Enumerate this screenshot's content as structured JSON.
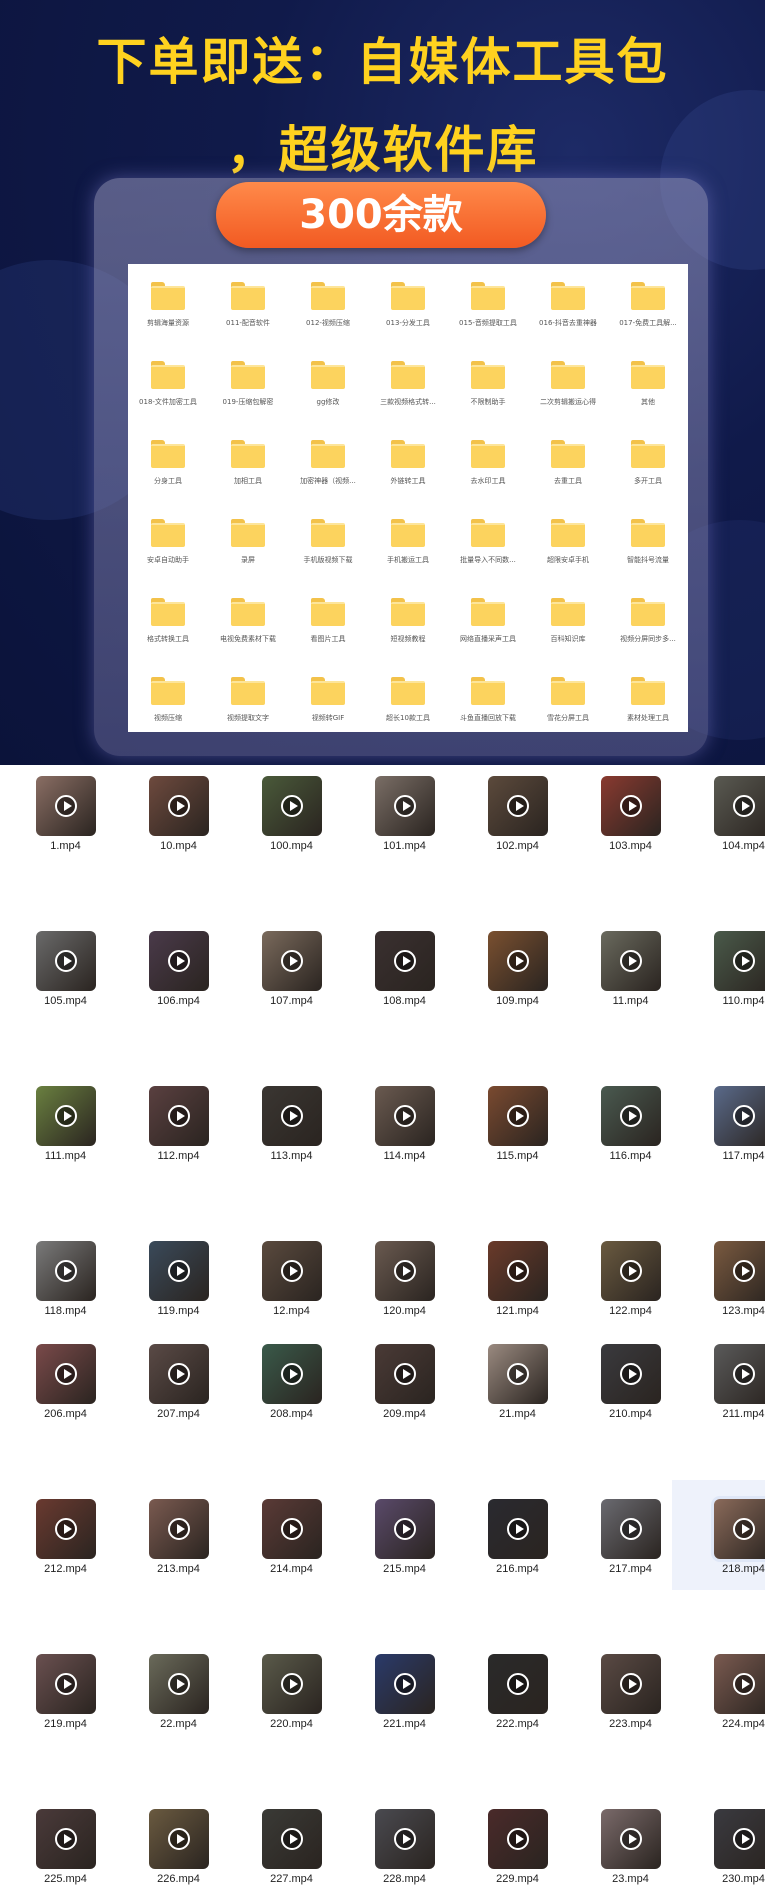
{
  "promo": {
    "title_line_1": "下单即送：自媒体工具包",
    "title_line_2": "，超级软件库",
    "badge": "300余款",
    "colors": {
      "title": "#ffd21f",
      "background": "#0b133a",
      "badge": "#f25a22",
      "folder": "#fcd35e"
    },
    "folders": [
      "剪辑海量资源",
      "011-配音软件",
      "012-视频压缩",
      "013-分发工具",
      "015-音频提取工具",
      "016-抖音去重神器",
      "017-免费工具解...",
      "018-文件加密工具",
      "019-压缩包解密",
      "gg修改",
      "三款视频格式转...",
      "不限制助手",
      "二次剪辑搬运心得",
      "其他",
      "分身工具",
      "加相工具",
      "加密神器（视频...",
      "外链转工具",
      "去水印工具",
      "去重工具",
      "多开工具",
      "安卓自动助手",
      "录屏",
      "手机版视频下载",
      "手机搬运工具",
      "批量导入不同数...",
      "超限安卓手机",
      "智能抖号流量",
      "格式转换工具",
      "电视免费素材下载",
      "看图片工具",
      "短视频教程",
      "网络直播采声工具",
      "百科知识库",
      "视频分屏同步多...",
      "视频压缩",
      "视频提取文字",
      "视频转GIF",
      "超长10款工具",
      "斗鱼直播回放下载",
      "雪花分屏工具",
      "素材处理工具"
    ]
  },
  "videos_section_1": {
    "files": [
      {
        "name": "1.mp4",
        "color": "#8a6e64"
      },
      {
        "name": "10.mp4",
        "color": "#6e4a3e"
      },
      {
        "name": "100.mp4",
        "color": "#4a5a3a"
      },
      {
        "name": "101.mp4",
        "color": "#7a6e66"
      },
      {
        "name": "102.mp4",
        "color": "#5c4a3c"
      },
      {
        "name": "103.mp4",
        "color": "#8a3a30"
      },
      {
        "name": "104.mp4",
        "color": "#5a5a52"
      },
      {
        "name": "105.mp4",
        "color": "#6a6a6a"
      },
      {
        "name": "106.mp4",
        "color": "#4a3a4a"
      },
      {
        "name": "107.mp4",
        "color": "#7a6a5c"
      },
      {
        "name": "108.mp4",
        "color": "#3a3030"
      },
      {
        "name": "109.mp4",
        "color": "#7a5030"
      },
      {
        "name": "11.mp4",
        "color": "#6a6a5e"
      },
      {
        "name": "110.mp4",
        "color": "#4a5a4a"
      },
      {
        "name": "111.mp4",
        "color": "#6a8040"
      },
      {
        "name": "112.mp4",
        "color": "#5a4040"
      },
      {
        "name": "113.mp4",
        "color": "#3a3632"
      },
      {
        "name": "114.mp4",
        "color": "#6a5a50"
      },
      {
        "name": "115.mp4",
        "color": "#7a4a30"
      },
      {
        "name": "116.mp4",
        "color": "#4a5a50"
      },
      {
        "name": "117.mp4",
        "color": "#5a6a8a"
      },
      {
        "name": "118.mp4",
        "color": "#7a7a7a"
      },
      {
        "name": "119.mp4",
        "color": "#3a4a5a"
      },
      {
        "name": "12.mp4",
        "color": "#5a4a3e"
      },
      {
        "name": "120.mp4",
        "color": "#6a5a50"
      },
      {
        "name": "121.mp4",
        "color": "#6a3a2a"
      },
      {
        "name": "122.mp4",
        "color": "#6a5a40"
      },
      {
        "name": "123.mp4",
        "color": "#7a5a40"
      }
    ]
  },
  "videos_section_2": {
    "files": [
      {
        "name": "206.mp4",
        "color": "#7a4a4a"
      },
      {
        "name": "207.mp4",
        "color": "#5a4a46"
      },
      {
        "name": "208.mp4",
        "color": "#3a5a4a"
      },
      {
        "name": "209.mp4",
        "color": "#4a3a36"
      },
      {
        "name": "21.mp4",
        "color": "#9a8a80"
      },
      {
        "name": "210.mp4",
        "color": "#3a3a3e"
      },
      {
        "name": "211.mp4",
        "color": "#5a5a5a"
      },
      {
        "name": "212.mp4",
        "color": "#6a3a30"
      },
      {
        "name": "213.mp4",
        "color": "#7a5a50"
      },
      {
        "name": "214.mp4",
        "color": "#5a3a36"
      },
      {
        "name": "215.mp4",
        "color": "#5a4a6a"
      },
      {
        "name": "216.mp4",
        "color": "#2a2a30"
      },
      {
        "name": "217.mp4",
        "color": "#6a6a70"
      },
      {
        "name": "218.mp4",
        "color": "#8a6a5a"
      },
      {
        "name": "219.mp4",
        "color": "#6a5050"
      },
      {
        "name": "22.mp4",
        "color": "#6a6a5a"
      },
      {
        "name": "220.mp4",
        "color": "#5a5a4a"
      },
      {
        "name": "221.mp4",
        "color": "#2a3a6a"
      },
      {
        "name": "222.mp4",
        "color": "#2a2a2a"
      },
      {
        "name": "223.mp4",
        "color": "#5a4a44"
      },
      {
        "name": "224.mp4",
        "color": "#7a5a50"
      },
      {
        "name": "225.mp4",
        "color": "#4a3a3a"
      },
      {
        "name": "226.mp4",
        "color": "#6a5a40"
      },
      {
        "name": "227.mp4",
        "color": "#3a3a36"
      },
      {
        "name": "228.mp4",
        "color": "#4a4a50"
      },
      {
        "name": "229.mp4",
        "color": "#4a2a2a"
      },
      {
        "name": "23.mp4",
        "color": "#7a6a6a"
      },
      {
        "name": "230.mp4",
        "color": "#3a3a40"
      }
    ],
    "selected": "218.mp4"
  }
}
